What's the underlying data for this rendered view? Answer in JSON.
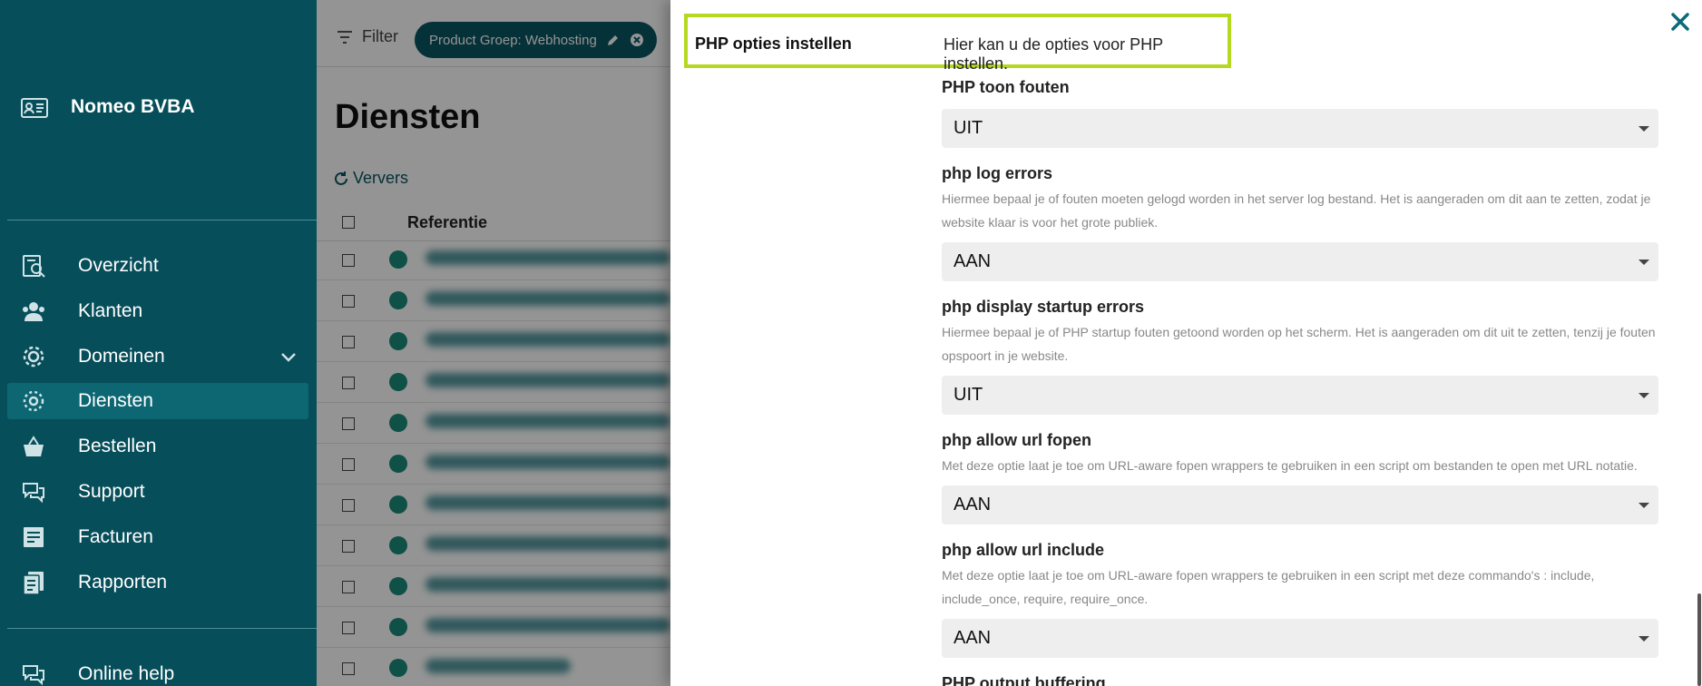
{
  "sidebar": {
    "company": "Nomeo BVBA",
    "items": [
      {
        "label": "Overzicht"
      },
      {
        "label": "Klanten"
      },
      {
        "label": "Domeinen"
      },
      {
        "label": "Diensten"
      },
      {
        "label": "Bestellen"
      },
      {
        "label": "Support"
      },
      {
        "label": "Facturen"
      },
      {
        "label": "Rapporten"
      }
    ],
    "help": "Online help"
  },
  "main": {
    "filter_label": "Filter",
    "chip_label": "Product Groep: Webhosting",
    "title": "Diensten",
    "refresh_label": "Ververs",
    "col_reference": "Referentie"
  },
  "panel": {
    "title": "PHP opties instellen",
    "description": "Hier kan u de opties voor PHP instellen.",
    "options": [
      {
        "label": "PHP toon fouten",
        "help": "",
        "value": "UIT"
      },
      {
        "label": "php log errors",
        "help": "Hiermee bepaal je of fouten moeten gelogd worden in het server log bestand. Het is aangeraden om dit aan te zetten, zodat je website klaar is voor het grote publiek.",
        "value": "AAN"
      },
      {
        "label": "php display startup errors",
        "help": "Hiermee bepaal je of PHP startup fouten getoond worden op het scherm. Het is aangeraden om dit uit te zetten, tenzij je fouten opspoort in je website.",
        "value": "UIT"
      },
      {
        "label": "php allow url fopen",
        "help": "Met deze optie laat je toe om URL-aware fopen wrappers te gebruiken in een script om bestanden te open met URL notatie.",
        "value": "AAN"
      },
      {
        "label": "php allow url include",
        "help": "Met deze optie laat je toe om URL-aware fopen wrappers te gebruiken in een script met deze commando's : include, include_once, require, require_once.",
        "value": "AAN"
      },
      {
        "label": "PHP output buffering",
        "help": "",
        "value": ""
      }
    ]
  },
  "colors": {
    "sidebar": "#064e5a",
    "accent": "#0a5561",
    "highlight": "#b5d91f"
  }
}
